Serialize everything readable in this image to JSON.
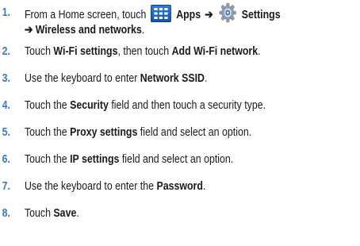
{
  "steps": [
    {
      "num": "1.",
      "prefix": "From a Home screen, touch",
      "apps": "Apps",
      "arrow": "➔",
      "settings": "Settings",
      "cont_arrow": "➔",
      "cont": "Wireless and networks",
      "end": "."
    },
    {
      "num": "2.",
      "a": "Touch ",
      "b": "Wi-Fi settings",
      "c": ", then touch ",
      "d": "Add Wi-Fi network",
      "e": "."
    },
    {
      "num": "3.",
      "a": "Use the keyboard to enter ",
      "b": "Network SSID",
      "c": "."
    },
    {
      "num": "4.",
      "a": "Touch the ",
      "b": "Security",
      "c": " field and then touch a security type."
    },
    {
      "num": "5.",
      "a": "Touch the ",
      "b": "Proxy settings",
      "c": " field and select an option."
    },
    {
      "num": "6.",
      "a": "Touch the ",
      "b": "IP settings",
      "c": " field and select an option."
    },
    {
      "num": "7.",
      "a": "Use the keyboard to enter the ",
      "b": "Password",
      "c": "."
    },
    {
      "num": "8.",
      "a": "Touch ",
      "b": "Save",
      "c": "."
    }
  ],
  "icons": {
    "apps": "apps-grid-icon",
    "settings": "settings-gear-icon"
  },
  "colors": {
    "step_number": "#3a7cb8",
    "apps_icon": "#1f6cc4"
  }
}
